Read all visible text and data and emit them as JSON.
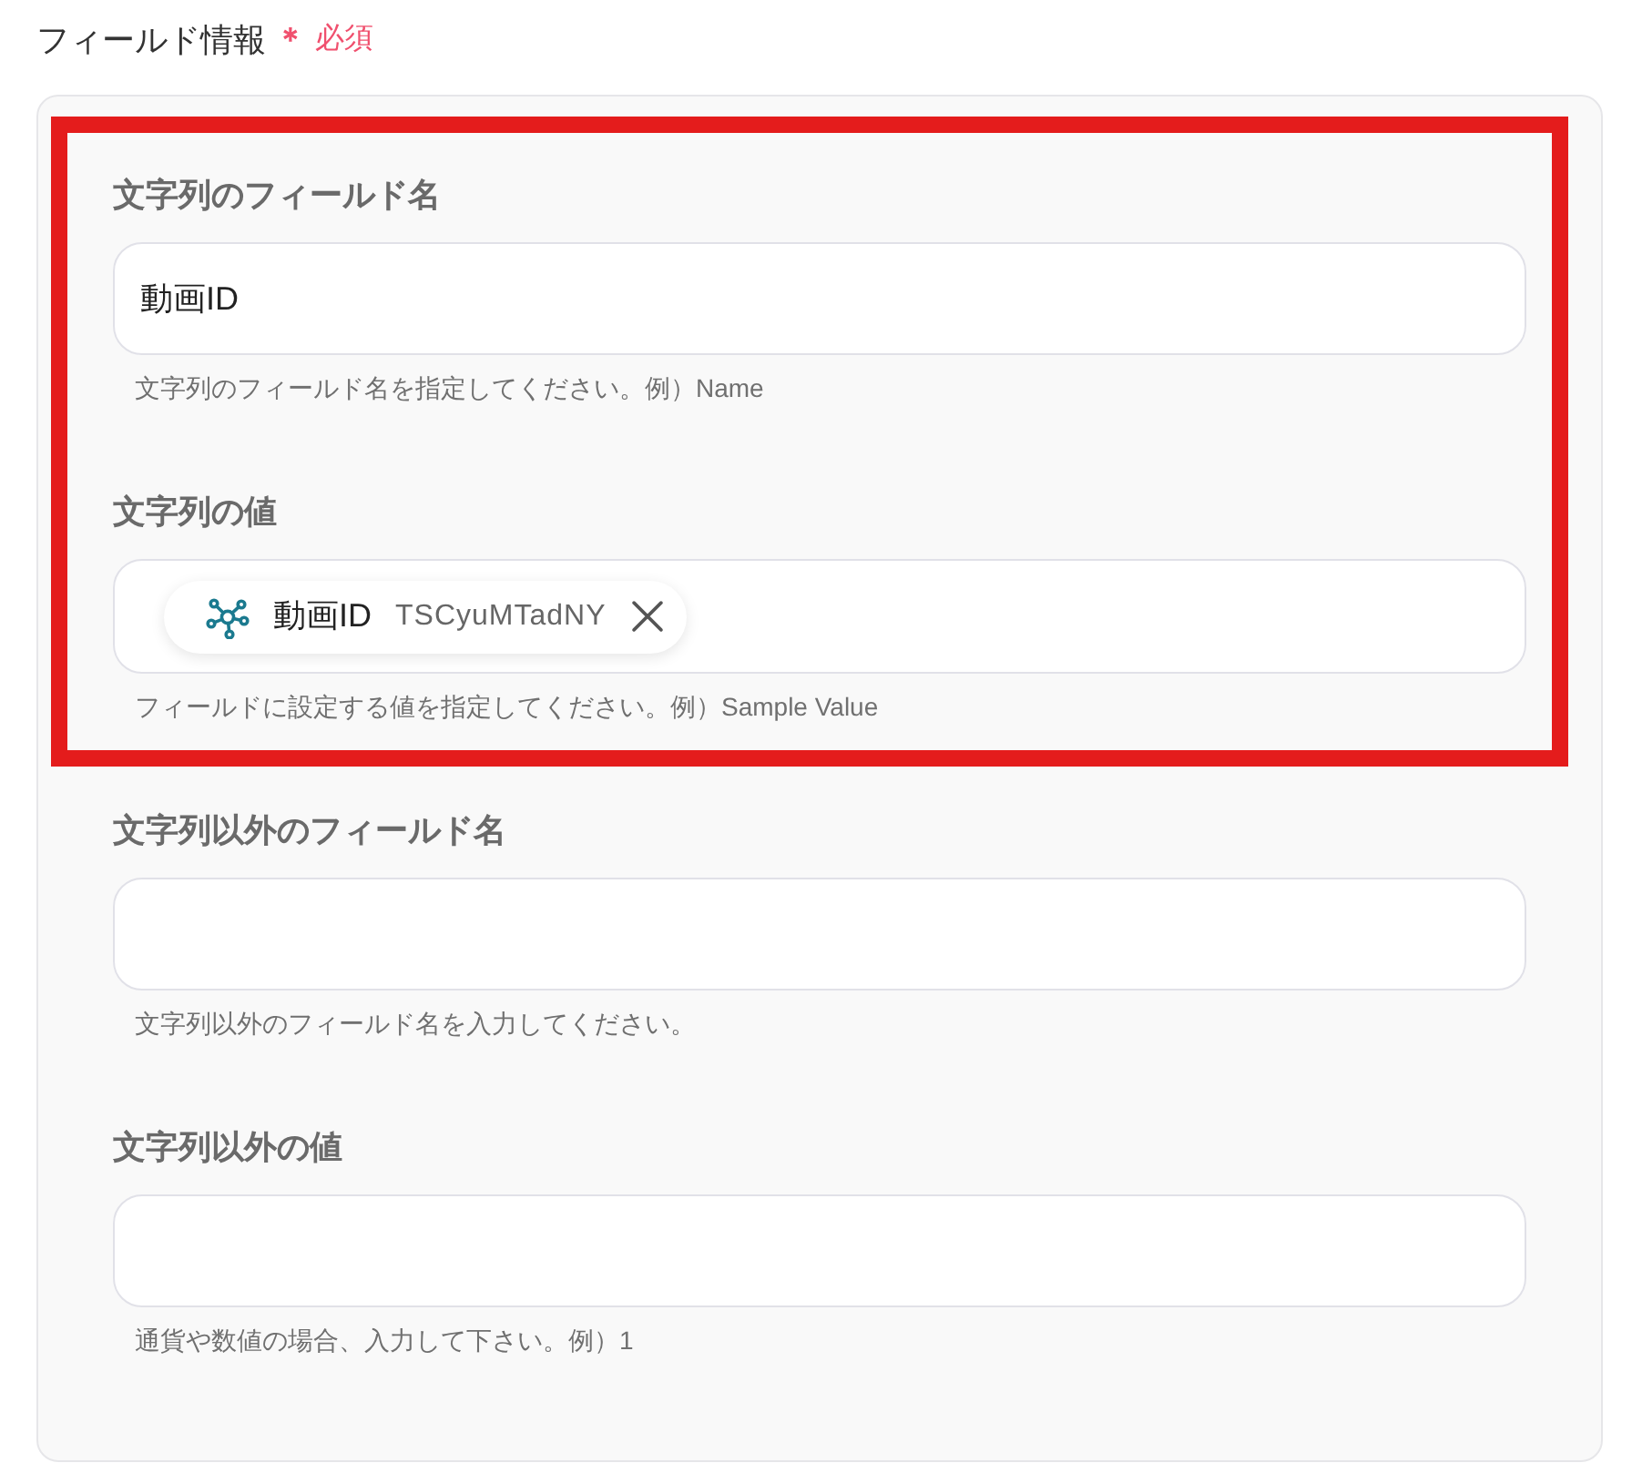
{
  "section": {
    "title": "フィールド情報",
    "required_mark": "＊",
    "required_label": "必須"
  },
  "fields": [
    {
      "label": "文字列のフィールド名",
      "kind": "text",
      "value": "動画ID",
      "help": "文字列のフィールド名を指定してください。例）Name",
      "highlighted": true
    },
    {
      "label": "文字列の値",
      "kind": "chips",
      "chips": [
        {
          "name": "動画ID",
          "value": "TSCyuMTadNY"
        }
      ],
      "help": "フィールドに設定する値を指定してください。例）Sample Value",
      "highlighted": true
    },
    {
      "label": "文字列以外のフィールド名",
      "kind": "text",
      "help": "文字列以外のフィールド名を入力してください。",
      "highlighted": false
    },
    {
      "label": "文字列以外の値",
      "kind": "text",
      "help": "通貨や数値の場合、入力して下さい。例）1",
      "highlighted": false
    }
  ]
}
